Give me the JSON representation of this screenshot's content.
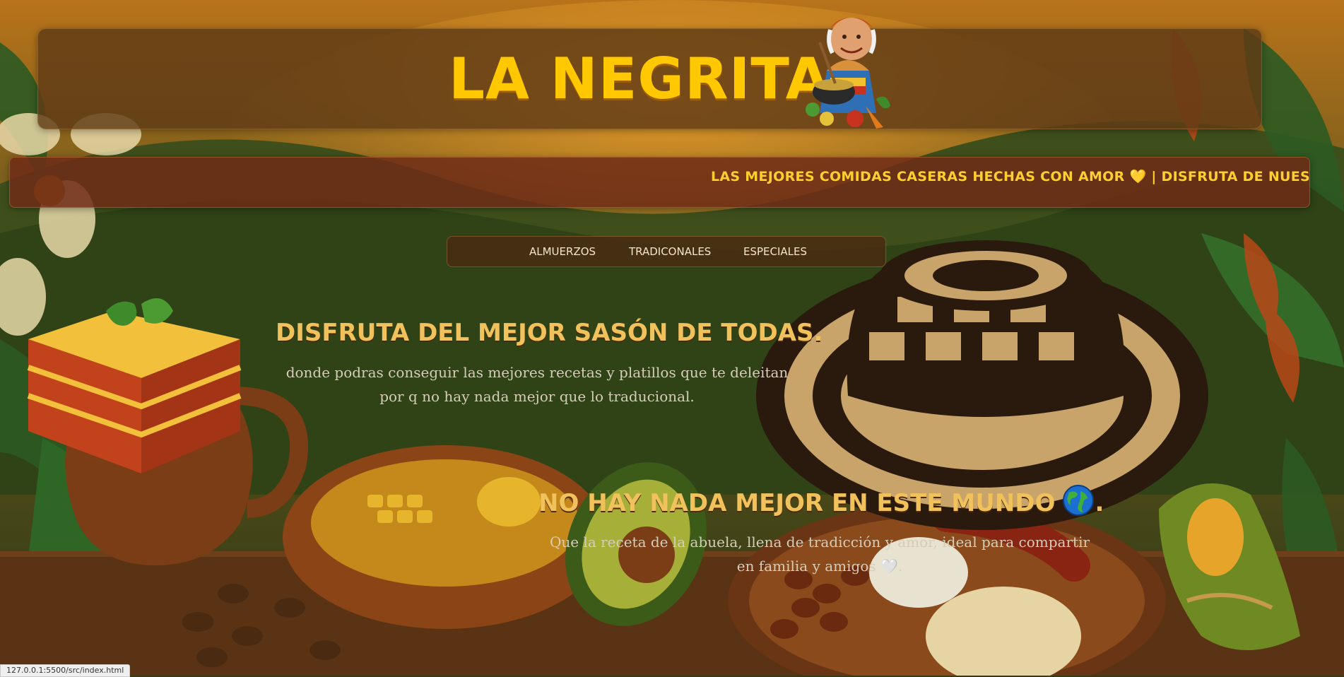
{
  "header": {
    "title": "LA NEGRITA"
  },
  "marquee": {
    "text": "LAS MEJORES COMIDAS CASERAS HECHAS CON AMOR 💛 | DISFRUTA DE NUESTRA"
  },
  "nav": {
    "items": [
      {
        "label": "ALMUERZOS"
      },
      {
        "label": "TRADICONALES"
      },
      {
        "label": "ESPECIALES"
      }
    ]
  },
  "section1": {
    "heading": "DISFRUTA DEL MEJOR SASÓN DE TODAS.",
    "paragraph": "donde podras conseguir las mejores recetas y platillos que te deleitan por q no hay nada mejor que lo traducional."
  },
  "section2": {
    "heading_text": "NO HAY NADA MEJOR EN ESTE MUNDO",
    "heading_suffix": ".",
    "paragraph": "Que la receta de la abuela, llena de tradicción y amor, ideal para compartir en familia y amigos 🤍."
  },
  "status_bar": {
    "url": "127.0.0.1:5500/src/index.html"
  },
  "colors": {
    "brand_yellow": "#ffc800",
    "heading_gold": "#f1c15c",
    "marquee_yellow": "#ffd02c",
    "panel_brown": "#5f3a16"
  },
  "icons": [
    "grandma-cook-mascot-icon",
    "globe-icon",
    "lasagna-illustration",
    "sombrero-vueltiao-illustration",
    "tamal-illustration"
  ]
}
